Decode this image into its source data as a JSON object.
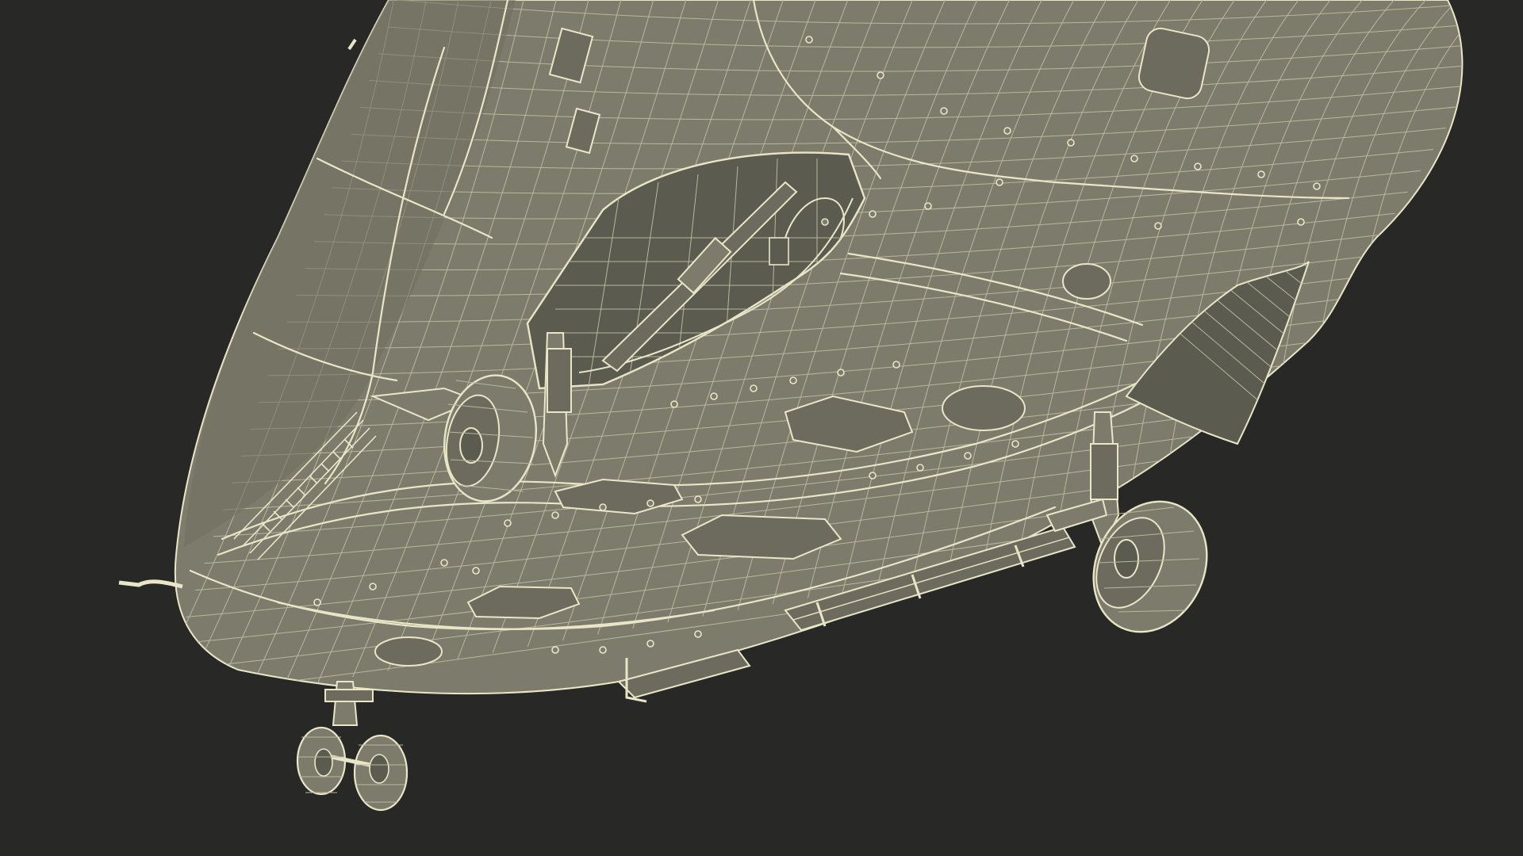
{
  "scene": {
    "subject": "helicopter-fuselage-underside-wireframe",
    "colors": {
      "background": "#282826",
      "surface": "#7d7c6c",
      "surface_shadow": "#5c5b4f",
      "surface_dark": "#46463d",
      "wire": "#e9e6c8",
      "wire_faint": "#b9b79d"
    },
    "mesh": {
      "fuselage_u_lines": 34,
      "fuselage_v_lines": 26
    }
  }
}
